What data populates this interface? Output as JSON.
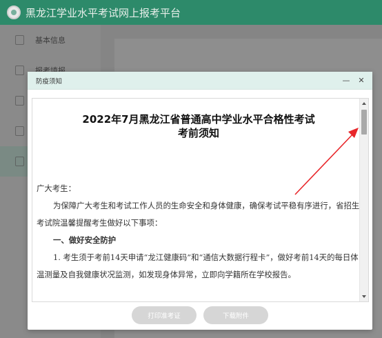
{
  "app": {
    "title": "黑龙江学业水平考试网上报考平台"
  },
  "sidebar": {
    "items": [
      {
        "label": "基本信息",
        "icon": "id-card-icon"
      },
      {
        "label": "报考填报",
        "icon": "form-icon"
      },
      {
        "label": "",
        "icon": "settings-icon"
      },
      {
        "label": "",
        "icon": "document-icon"
      },
      {
        "label": "",
        "icon": "chart-icon"
      }
    ]
  },
  "modal": {
    "title": "防疫须知",
    "minimize": "—",
    "close": "✕",
    "doc": {
      "title_line1": "2022年7月黑龙江省普通高中学业水平合格性考试",
      "title_line2": "考前须知",
      "greeting": "广大考生：",
      "intro": "为保障广大考生和考试工作人员的生命安全和身体健康，确保考试平稳有序进行，省招生考试院温馨提醒考生做好以下事项：",
      "section1_heading": "一、做好安全防护",
      "item1": "1. 考生须于考前14天申请“龙江健康码”和“通信大数据行程卡”，做好考前14天的每日体温测量及自我健康状况监测，如发现身体异常，立即向学籍所在学校报告。"
    },
    "buttons": {
      "print": "打印准考证",
      "download": "下载附件"
    }
  },
  "colors": {
    "header": "#2d8a6a",
    "modal_titlebar": "#dff0ec",
    "button_disabled": "#d6d6d6",
    "annotation_arrow": "#e8262a"
  }
}
